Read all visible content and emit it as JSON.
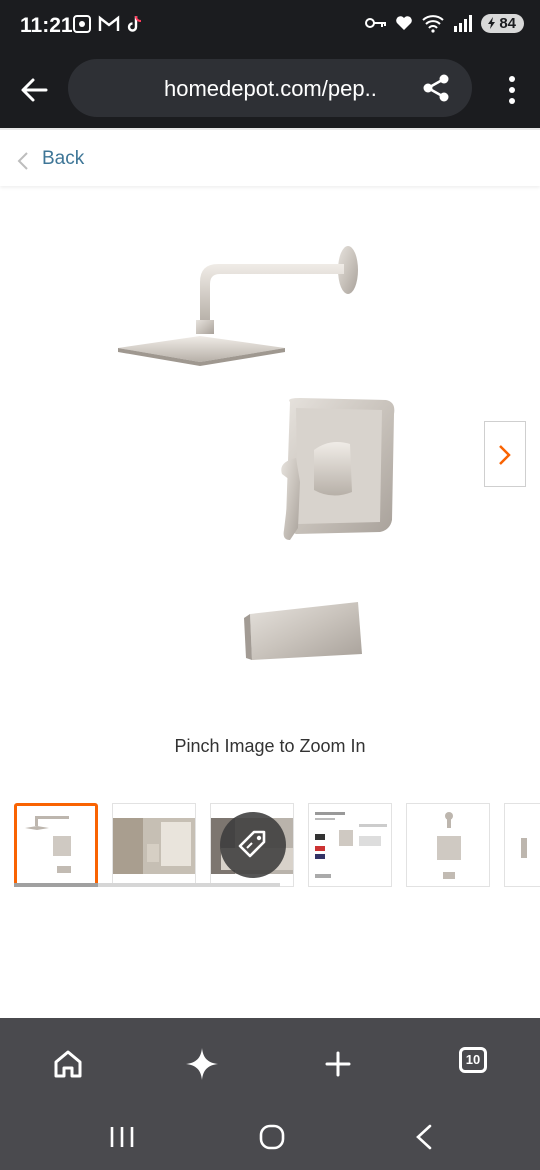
{
  "status_bar": {
    "time": "11:21",
    "battery": "84",
    "left_icons": [
      "screenshot-icon",
      "gmail-icon",
      "tiktok-icon"
    ],
    "right_icons": [
      "key-icon",
      "heart-icon",
      "wifi-icon",
      "signal-icon",
      "battery-icon"
    ]
  },
  "browser": {
    "url": "homedepot.com/pep..",
    "back_icon": "back-arrow-icon",
    "share_icon": "share-icon",
    "menu_icon": "more-vert-icon"
  },
  "page": {
    "back_label": "Back",
    "zoom_hint": "Pinch Image to Zoom In",
    "accent_color": "#f96302",
    "link_color": "#3e7697"
  },
  "gallery": {
    "thumbnails": [
      {
        "name": "shower-faucet-set"
      },
      {
        "name": "bathroom-scene"
      },
      {
        "name": "bathroom-vanity"
      },
      {
        "name": "spec-sheet"
      },
      {
        "name": "faucet-diagram"
      }
    ],
    "active_index": 0
  },
  "bottom_nav": {
    "items": [
      "home-icon",
      "sparkle-icon",
      "plus-icon",
      "tabs-icon"
    ],
    "tab_count": "10"
  },
  "system_nav": [
    "recents-icon",
    "home-circle-icon",
    "back-icon"
  ]
}
